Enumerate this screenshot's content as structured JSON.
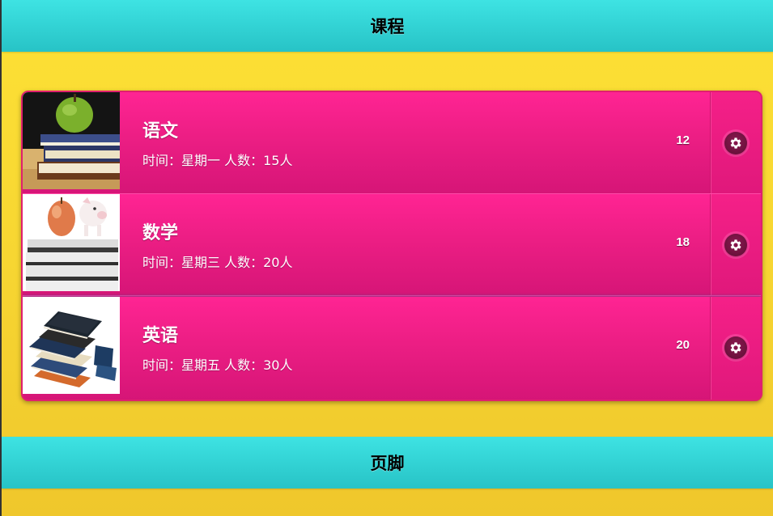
{
  "header": {
    "title": "课程"
  },
  "footer": {
    "title": "页脚"
  },
  "courses": [
    {
      "title": "语文",
      "desc": "时间：星期一 人数：15人",
      "count": "12",
      "thumb_icon": "books-with-apple-icon"
    },
    {
      "title": "数学",
      "desc": "时间：星期三 人数：20人",
      "count": "18",
      "thumb_icon": "apple-and-piggy-bank-on-books-icon"
    },
    {
      "title": "英语",
      "desc": "时间：星期五 人数：30人",
      "count": "20",
      "thumb_icon": "stack-of-books-icon"
    }
  ],
  "split_icon": "gear-icon",
  "colors": {
    "bar": "#2fd3d6",
    "background": "#f7d632",
    "row": "#ec1e84"
  }
}
